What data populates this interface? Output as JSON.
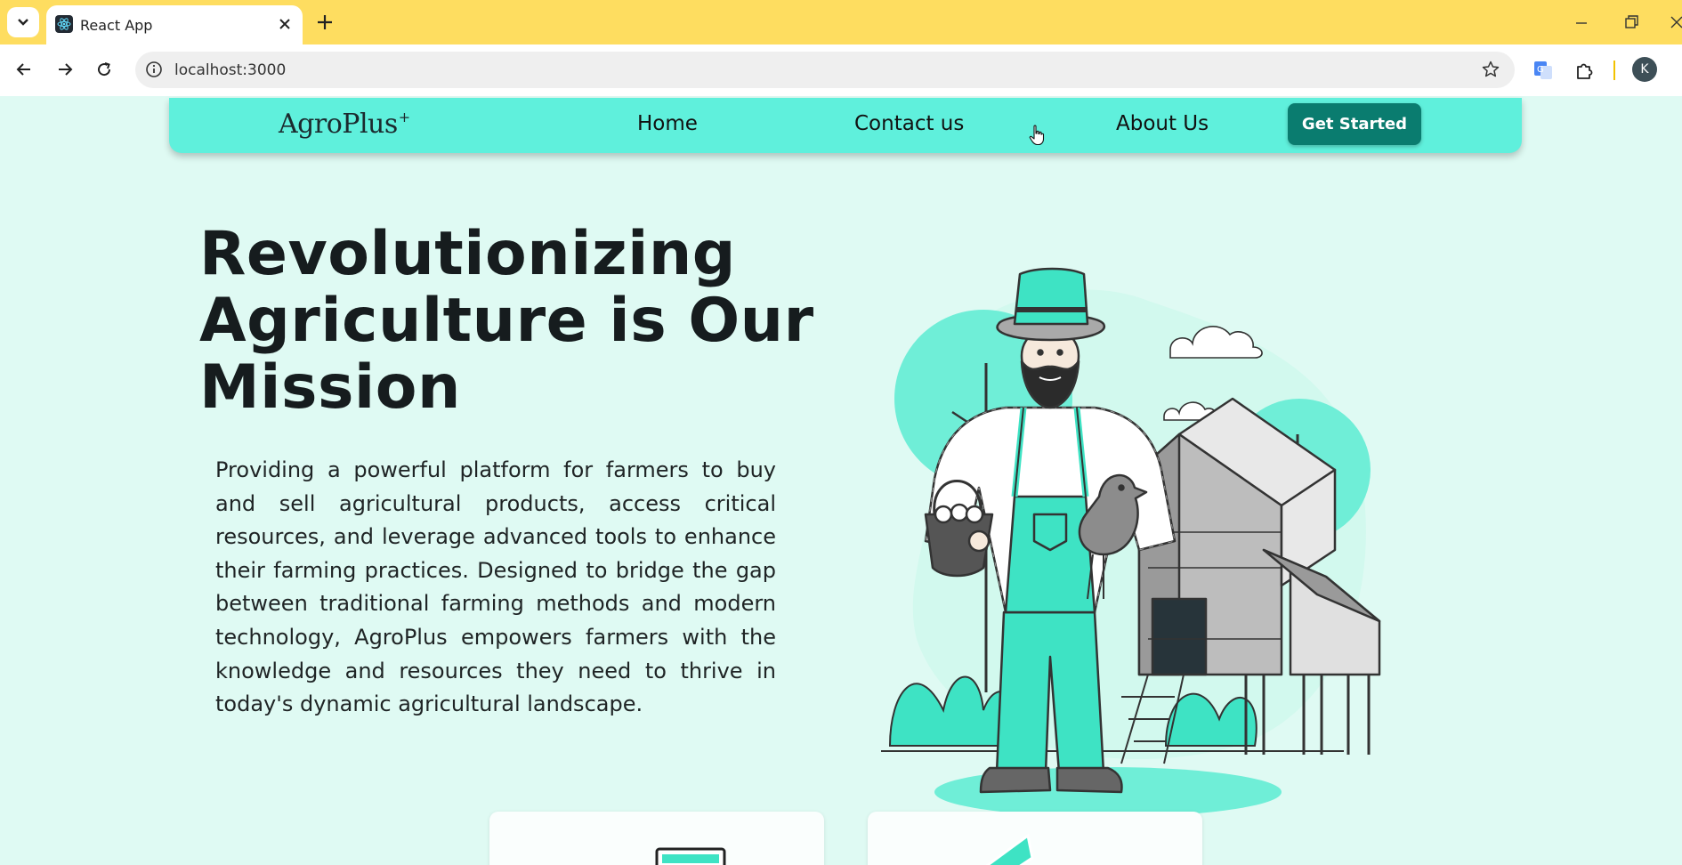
{
  "browser": {
    "tab_title": "React App",
    "url": "localhost:3000",
    "profile_initial": "K"
  },
  "navbar": {
    "logo": "AgroPlus",
    "logo_mark": "+",
    "links": [
      "Home",
      "Contact us",
      "About Us"
    ],
    "cta_label": "Get Started"
  },
  "hero": {
    "title": "Revolutionizing Agriculture is Our Mission",
    "description": "Providing a powerful platform for farmers to buy and sell agricultural products, access critical resources, and leverage advanced tools to enhance their farming practices. Designed to bridge the gap between traditional farming methods and modern technology, AgroPlus empowers farmers with the knowledge and resources they need to thrive in today's dynamic agricultural landscape."
  },
  "colors": {
    "tabstrip": "#fedd60",
    "navbar": "#5ff0dc",
    "accent": "#0a7c6f",
    "page_bg": "#dffaf3",
    "illustration_primary": "#3ee3c4"
  }
}
